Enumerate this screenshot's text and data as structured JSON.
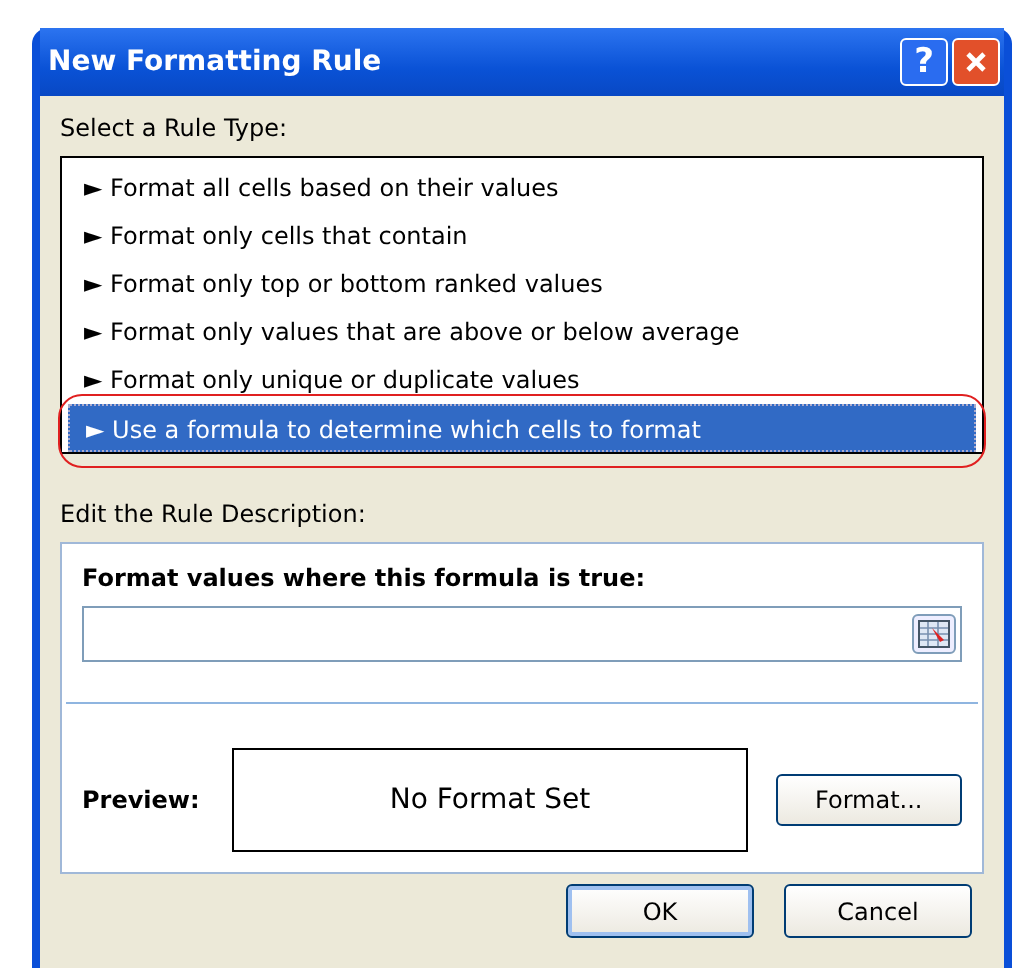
{
  "window": {
    "title": "New Formatting Rule",
    "help_button": "?"
  },
  "rule_type": {
    "label": "Select a Rule Type:",
    "items": [
      {
        "label": "► Format all cells based on their values",
        "selected": false,
        "circled": false
      },
      {
        "label": "► Format only cells that contain",
        "selected": false,
        "circled": false
      },
      {
        "label": "► Format only top or bottom ranked values",
        "selected": false,
        "circled": false
      },
      {
        "label": "► Format only values that are above or below average",
        "selected": false,
        "circled": false
      },
      {
        "label": "► Format only unique or duplicate values",
        "selected": false,
        "circled": false
      },
      {
        "label": "► Use a formula to determine which cells to format",
        "selected": true,
        "circled": true
      }
    ]
  },
  "description": {
    "label": "Edit the Rule Description:",
    "formula_label": "Format values where this formula is true:",
    "preview_label": "Preview:",
    "preview_text": "No Format Set",
    "format_button": "Format..."
  },
  "buttons": [
    "OK",
    "Cancel"
  ]
}
